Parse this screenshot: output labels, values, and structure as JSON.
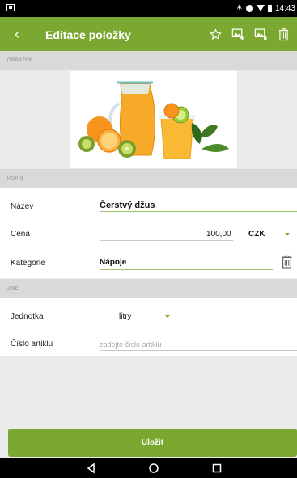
{
  "status_bar": {
    "time": "14:43"
  },
  "app_bar": {
    "back_glyph": "‹",
    "title": "Editace položky",
    "actions": [
      "star-outline-icon",
      "image-add-icon",
      "image-remove-icon",
      "trash-icon"
    ]
  },
  "sections": {
    "image": "OBRÁZEK",
    "description": "POPIS",
    "other": "JINÉ"
  },
  "form": {
    "name_label": "Název",
    "name_value": "Čerstvý džus",
    "price_label": "Cena",
    "price_value": "100,00",
    "currency": "CZK",
    "category_label": "Kategorie",
    "category_value": "Nápoje",
    "unit_label": "Jednotka",
    "unit_value": "litry",
    "article_label": "Číslo artiklu",
    "article_placeholder": "zadejte číslo artiklu"
  },
  "save_button": "Uložit",
  "colors": {
    "accent": "#7ba831",
    "section_bg": "#d9d9d9",
    "underline": "#9fc46a"
  }
}
